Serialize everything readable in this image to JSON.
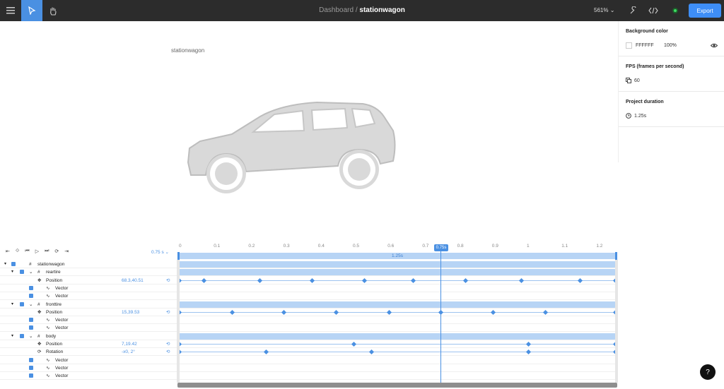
{
  "header": {
    "breadcrumb_parent": "Dashboard",
    "breadcrumb_sep": " / ",
    "breadcrumb_current": "stationwagon",
    "zoom": "561%",
    "export_label": "Export"
  },
  "canvas": {
    "label": "stationwagon"
  },
  "properties": {
    "bg_title": "Background color",
    "bg_hex": "FFFFFF",
    "bg_opacity": "100%",
    "fps_title": "FPS (frames per second)",
    "fps_value": "60",
    "duration_title": "Project duration",
    "duration_value": "1.25s"
  },
  "timeline": {
    "current_time": "0.75 s",
    "playhead_label": "0.75s",
    "range_label": "1.25s",
    "ruler": [
      "0",
      "0.1",
      "0.2",
      "0.3",
      "0.4",
      "0.5",
      "0.6",
      "0.7",
      "0.8",
      "0.9",
      "1",
      "1.1",
      "1.2"
    ],
    "rows": [
      {
        "label": "stationwagon",
        "value": ""
      },
      {
        "label": "reartire",
        "value": ""
      },
      {
        "label": "Position",
        "value": "68.3,40.51"
      },
      {
        "label": "Vector",
        "value": ""
      },
      {
        "label": "Vector",
        "value": ""
      },
      {
        "label": "fronttire",
        "value": ""
      },
      {
        "label": "Position",
        "value": "15,39.53"
      },
      {
        "label": "Vector",
        "value": ""
      },
      {
        "label": "Vector",
        "value": ""
      },
      {
        "label": "body",
        "value": ""
      },
      {
        "label": "Position",
        "value": "7,19.42"
      },
      {
        "label": "Rotation",
        "value": "-x0, 2°"
      },
      {
        "label": "Vector",
        "value": ""
      },
      {
        "label": "Vector",
        "value": ""
      },
      {
        "label": "Vector",
        "value": ""
      }
    ]
  },
  "help_label": "?",
  "colors": {
    "accent": "#4a90e2",
    "topbar": "#2c2c2c",
    "export": "#3e8ef7"
  }
}
